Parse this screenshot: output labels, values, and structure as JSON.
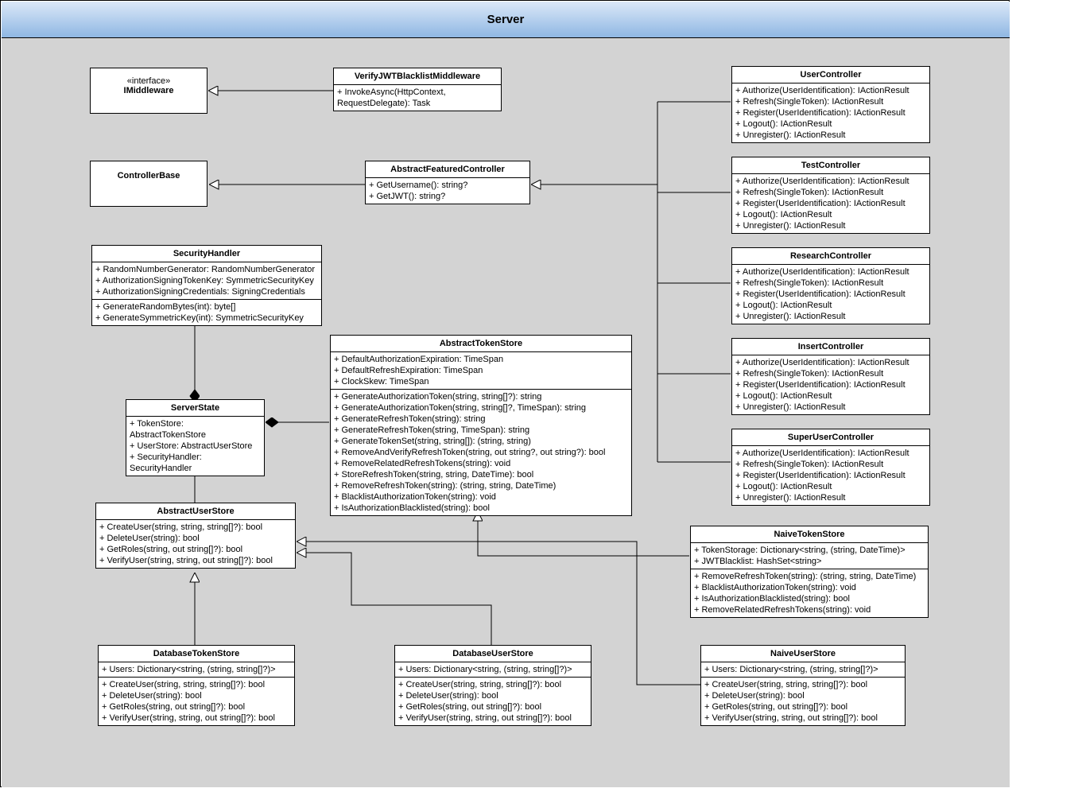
{
  "package_title": "Server",
  "imiddleware": {
    "stereotype": "«interface»",
    "name": "IMiddleware"
  },
  "controllerbase": {
    "name": "ControllerBase"
  },
  "verifyjwt": {
    "name": "VerifyJWTBlacklistMiddleware",
    "ops": [
      "+ InvokeAsync(HttpContext, RequestDelegate): Task"
    ]
  },
  "abstractfeatured": {
    "name": "AbstractFeaturedController",
    "ops": [
      "+ GetUsername(): string?",
      "+ GetJWT(): string?"
    ]
  },
  "securityhandler": {
    "name": "SecurityHandler",
    "attrs": [
      "+ RandomNumberGenerator: RandomNumberGenerator",
      "+ AuthorizationSigningTokenKey: SymmetricSecurityKey",
      "+ AuthorizationSigningCredentials: SigningCredentials"
    ],
    "ops": [
      "+ GenerateRandomBytes(int): byte[]",
      "+ GenerateSymmetricKey(int): SymmetricSecurityKey"
    ]
  },
  "serverstate": {
    "name": "ServerState",
    "attrs": [
      "+ TokenStore: AbstractTokenStore",
      "+ UserStore: AbstractUserStore",
      "+ SecurityHandler: SecurityHandler"
    ]
  },
  "abstractuserstore": {
    "name": "AbstractUserStore",
    "ops": [
      "+ CreateUser(string, string, string[]?): bool",
      "+ DeleteUser(string): bool",
      "+ GetRoles(string, out string[]?): bool",
      "+ VerifyUser(string, string, out string[]?): bool"
    ]
  },
  "abstracttokenstore": {
    "name": "AbstractTokenStore",
    "attrs": [
      "+ DefaultAuthorizationExpiration: TimeSpan",
      "+ DefaultRefreshExpiration: TimeSpan",
      "+ ClockSkew: TimeSpan"
    ],
    "ops": [
      "+ GenerateAuthorizationToken(string, string[]?): string",
      "+ GenerateAuthorizationToken(string, string[]?, TimeSpan): string",
      "+ GenerateRefreshToken(string): string",
      "+ GenerateRefreshToken(string, TimeSpan): string",
      "+ GenerateTokenSet(string, string[]): (string, string)",
      "+ RemoveAndVerifyRefreshToken(string, out string?, out string?): bool",
      "+ RemoveRelatedRefreshTokens(string): void",
      "+ StoreRefreshToken(string, string, DateTime): bool",
      "+ RemoveRefreshToken(string): (string, string, DateTime)",
      "+ BlacklistAuthorizationToken(string): void",
      "+ IsAuthorizationBlacklisted(string): bool"
    ]
  },
  "controllers_ops": [
    "+ Authorize(UserIdentification): IActionResult",
    "+ Refresh(SingleToken): IActionResult",
    "+ Register(UserIdentification): IActionResult",
    "+ Logout(): IActionResult",
    "+ Unregister(): IActionResult"
  ],
  "usercontroller": "UserController",
  "testcontroller": "TestController",
  "researchcontroller": "ResearchController",
  "insertcontroller": "InsertController",
  "superusercontroller": "SuperUserController",
  "databasetokenstore": {
    "name": "DatabaseTokenStore",
    "attrs": [
      "+ Users: Dictionary<string, (string, string[]?)>"
    ],
    "ops": [
      "+ CreateUser(string, string, string[]?): bool",
      "+ DeleteUser(string): bool",
      "+ GetRoles(string, out string[]?): bool",
      "+ VerifyUser(string, string, out string[]?): bool"
    ]
  },
  "databaseuserstore": {
    "name": "DatabaseUserStore",
    "attrs": [
      "+ Users: Dictionary<string, (string, string[]?)>"
    ],
    "ops": [
      "+ CreateUser(string, string, string[]?): bool",
      "+ DeleteUser(string): bool",
      "+ GetRoles(string, out string[]?): bool",
      "+ VerifyUser(string, string, out string[]?): bool"
    ]
  },
  "naiveuserstore": {
    "name": "NaiveUserStore",
    "attrs": [
      "+ Users: Dictionary<string, (string, string[]?)>"
    ],
    "ops": [
      "+ CreateUser(string, string, string[]?): bool",
      "+ DeleteUser(string): bool",
      "+ GetRoles(string, out string[]?): bool",
      "+ VerifyUser(string, string, out string[]?): bool"
    ]
  },
  "naivetokenstore": {
    "name": "NaiveTokenStore",
    "attrs": [
      "+ TokenStorage: Dictionary<string, (string, DateTime)>",
      "+ JWTBlacklist: HashSet<string>"
    ],
    "ops": [
      "+ RemoveRefreshToken(string): (string, string, DateTime)",
      "+ BlacklistAuthorizationToken(string): void",
      "+ IsAuthorizationBlacklisted(string): bool",
      "+ RemoveRelatedRefreshTokens(string): void"
    ]
  }
}
